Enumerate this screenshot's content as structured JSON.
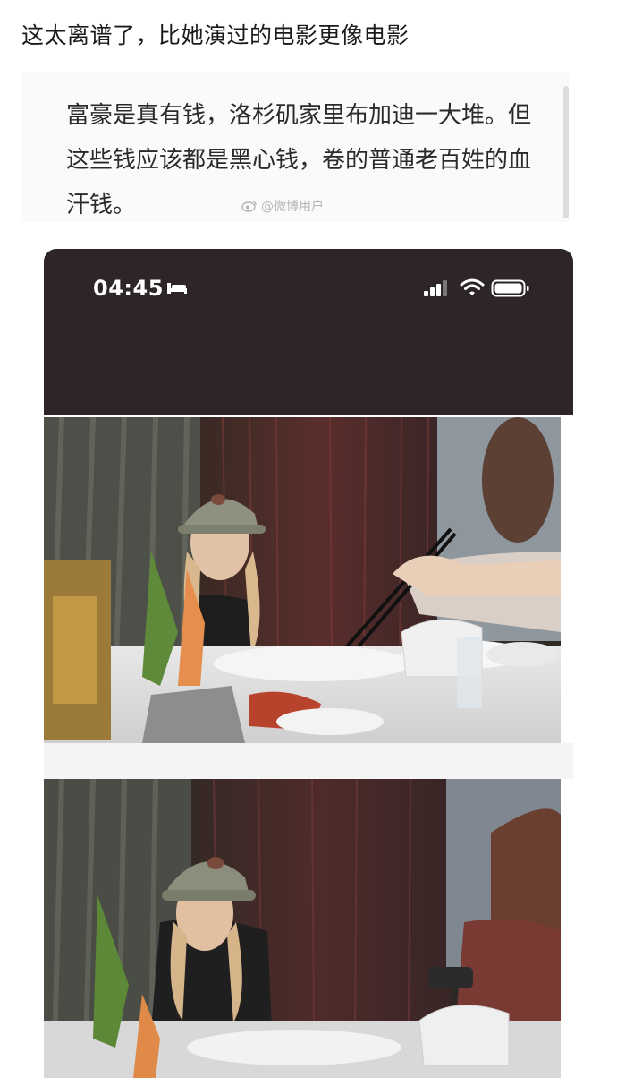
{
  "post": {
    "title": "这太离谱了，比她演过的电影更像电影"
  },
  "quote": {
    "text": "富豪是真有钱，洛杉矶家里布加迪一大堆。但这些钱应该都是黑心钱，卷的普通老百姓的血汗钱。",
    "watermark": "@微博用户"
  },
  "phone": {
    "status_time": "04:45",
    "icons": {
      "bed": "bed-icon",
      "signal": "signal-icon",
      "wifi": "wifi-icon",
      "battery": "battery-icon"
    },
    "header_color": "#2d2526"
  },
  "photos": [
    {
      "name": "restaurant-photo-1",
      "description_icon": "photo-icon"
    },
    {
      "name": "restaurant-photo-2",
      "description_icon": "photo-icon"
    }
  ]
}
